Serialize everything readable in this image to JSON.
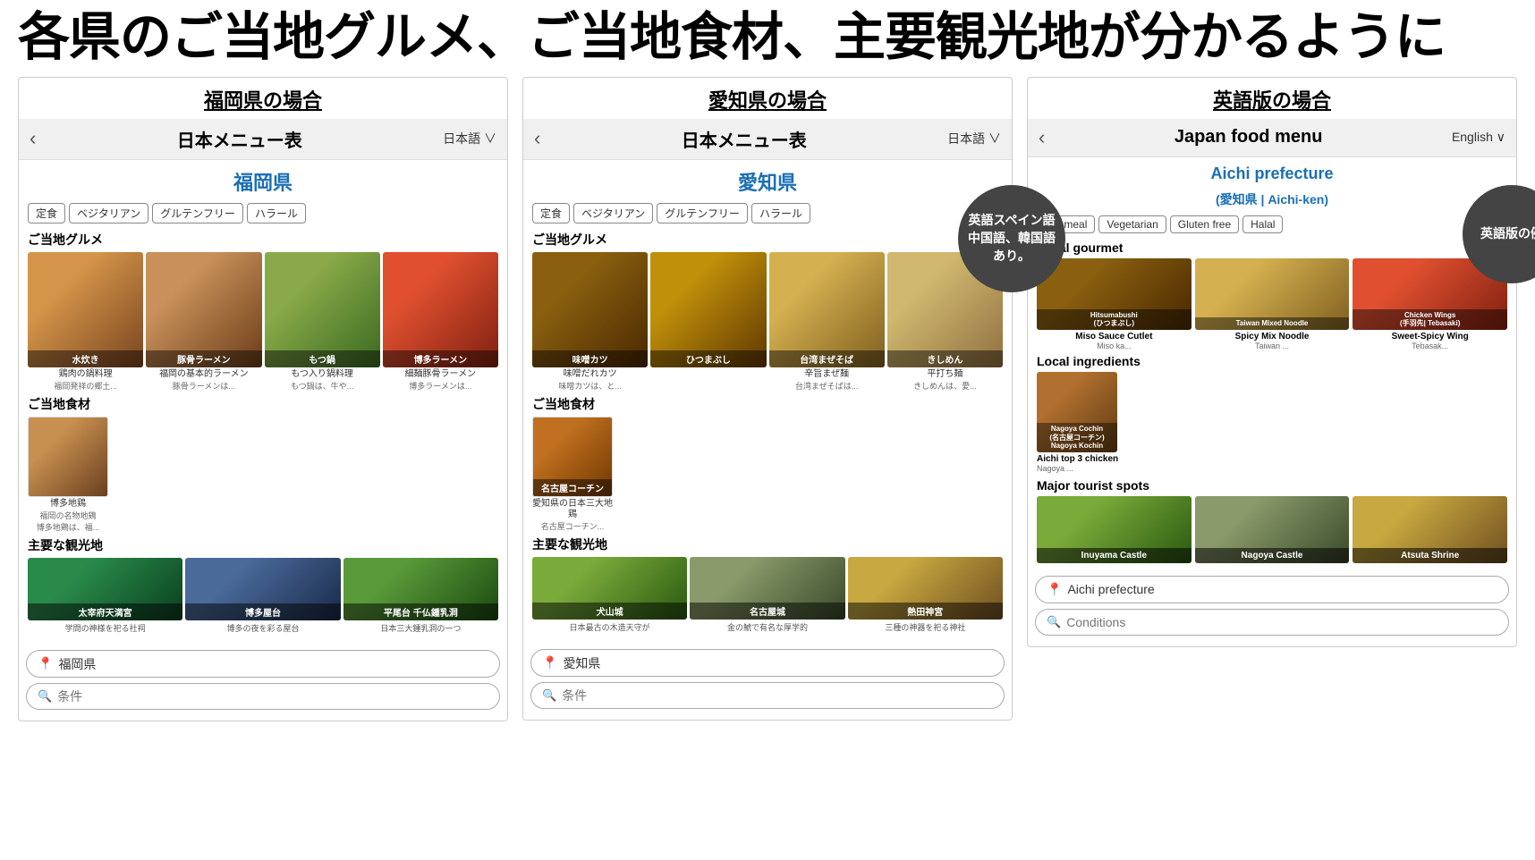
{
  "main_title": "各県のご当地グルメ、ご当地食材、主要観光地が分かるように",
  "panels": [
    {
      "id": "fukuoka",
      "panel_label": "福岡県の場合",
      "header": {
        "back": "‹",
        "title": "日本メニュー表",
        "lang": "日本語 ∨"
      },
      "prefecture": "福岡県",
      "filters": [
        "定食",
        "ベジタリアン",
        "グルテンフリー",
        "ハラール"
      ],
      "gourmet_label": "ご当地グルメ",
      "gourmet_items": [
        {
          "name": "水炊き",
          "caption": "鶏肉の鍋料理",
          "sub": "福岡発祥の郷土...",
          "color": "img-mizutaki"
        },
        {
          "name": "豚骨ラーメン",
          "caption": "福岡の基本的ラーメン",
          "sub": "豚骨ラーメンは...",
          "color": "img-tonkotsu"
        },
        {
          "name": "もつ鍋",
          "caption": "もつ入り鍋料理",
          "sub": "もつ鍋は、牛や...",
          "color": "img-motsu"
        },
        {
          "name": "博多ラーメン",
          "caption": "細麺豚骨ラーメン",
          "sub": "博多ラーメンは...",
          "color": "img-hakata-ramen"
        }
      ],
      "ingredients_label": "ご当地食材",
      "ingredients": [
        {
          "name": "博多地鶏",
          "caption": "福岡の名物地鶏",
          "sub": "博多地鶏は、福...",
          "color": "img-hakata-chicken"
        }
      ],
      "tourist_label": "主要な観光地",
      "tourist_items": [
        {
          "name": "太宰府天満宮",
          "caption": "学問の神様を祀る社祠",
          "color": "img-dazaifu"
        },
        {
          "name": "博多屋台",
          "caption": "博多の夜を彩る屋台",
          "color": "img-hakata-yatai"
        },
        {
          "name": "平尾台 千仏鍾乳洞",
          "caption": "日本三大鍾乳洞の一つ",
          "color": "img-hiraodai"
        }
      ],
      "search_prefecture": "福岡県",
      "search_conditions_placeholder": "条件"
    },
    {
      "id": "aichi",
      "panel_label": "愛知県の場合",
      "header": {
        "back": "‹",
        "title": "日本メニュー表",
        "lang": "日本語 ∨"
      },
      "prefecture": "愛知県",
      "speech_bubble": "英語スペイン語中国語、韓国語あり。",
      "filters": [
        "定食",
        "ベジタリアン",
        "グルテンフリー",
        "ハラール"
      ],
      "gourmet_label": "ご当地グルメ",
      "gourmet_items": [
        {
          "name": "味噌カツ",
          "caption": "味噌だれカツ",
          "sub": "味噌カツは、と...",
          "color": "img-misokatsu"
        },
        {
          "name": "ひつまぶし",
          "caption": "",
          "sub": "",
          "color": "img-hitsumabushi"
        },
        {
          "name": "台湾まぜそば",
          "caption": "辛旨まぜ麺",
          "sub": "台湾まぜそばは...",
          "color": "img-taiwan-maze"
        },
        {
          "name": "きしめん",
          "caption": "平打ち麺",
          "sub": "きしめんは、愛...",
          "color": "img-kishimen"
        }
      ],
      "ingredients_label": "ご当地食材",
      "ingredients": [
        {
          "name": "名古屋コーチン",
          "caption": "愛知県の日本三大地鶏",
          "sub": "名古屋コーチン...",
          "color": "img-nagoya-cochin"
        }
      ],
      "tourist_label": "主要な観光地",
      "tourist_items": [
        {
          "name": "犬山城",
          "caption": "日本最古の木造天守が",
          "color": "img-inuyama"
        },
        {
          "name": "名古屋城",
          "caption": "金の鯱で有名な厚学的",
          "color": "img-nagoya-castle2"
        },
        {
          "name": "熱田神宮",
          "caption": "三種の神器を祀る神社",
          "color": "img-atsuta"
        }
      ],
      "search_prefecture": "愛知県",
      "search_conditions_placeholder": "条件"
    },
    {
      "id": "english",
      "panel_label": "英語版の場合",
      "header": {
        "back": "‹",
        "title": "Japan food menu",
        "lang": "English ∨"
      },
      "prefecture_en": "Aichi prefecture",
      "prefecture_jp": "(愛知県 | Aichi-ken)",
      "speech_bubble": "英語版の例",
      "filters": [
        "Set meal",
        "Vegetarian",
        "Gluten free",
        "Halal"
      ],
      "gourmet_label": "Local gourmet",
      "gourmet_items": [
        {
          "name": "Hitsumabushi\n(ひつまぶし)",
          "caption": "Miso Sauce Cutlet",
          "sub": "Miso ka...",
          "color": "img-misokatsu"
        },
        {
          "name": "Taiwan Mixed Noodle",
          "caption": "Spicy Mix Noodle",
          "sub": "Taiwan ...",
          "color": "img-taiwan-maze"
        },
        {
          "name": "Chicken Wings\n(手羽先| Tebasaki)",
          "caption": "Sweet-Spicy Wing",
          "sub": "Tebasak...",
          "color": "img-hakata-ramen"
        }
      ],
      "ingredients_label": "Local ingredients",
      "ingredients": [
        {
          "name": "Nagoya Cochin\n(名古屋コーチン) Nagoya Kochin",
          "caption": "Aichi top 3 chicken",
          "sub": "Nagoya ...",
          "color": "img-nagoya-cochin-en"
        }
      ],
      "tourist_label": "Major tourist spots",
      "tourist_items": [
        {
          "name": "Inuyama Castle",
          "color": "img-inuyama"
        },
        {
          "name": "Nagoya Castle",
          "color": "img-nagoya-castle2"
        },
        {
          "name": "Atsuta Shrine",
          "color": "img-atsuta"
        }
      ],
      "search_prefecture": "Aichi prefecture",
      "search_conditions_placeholder": "Conditions"
    }
  ]
}
